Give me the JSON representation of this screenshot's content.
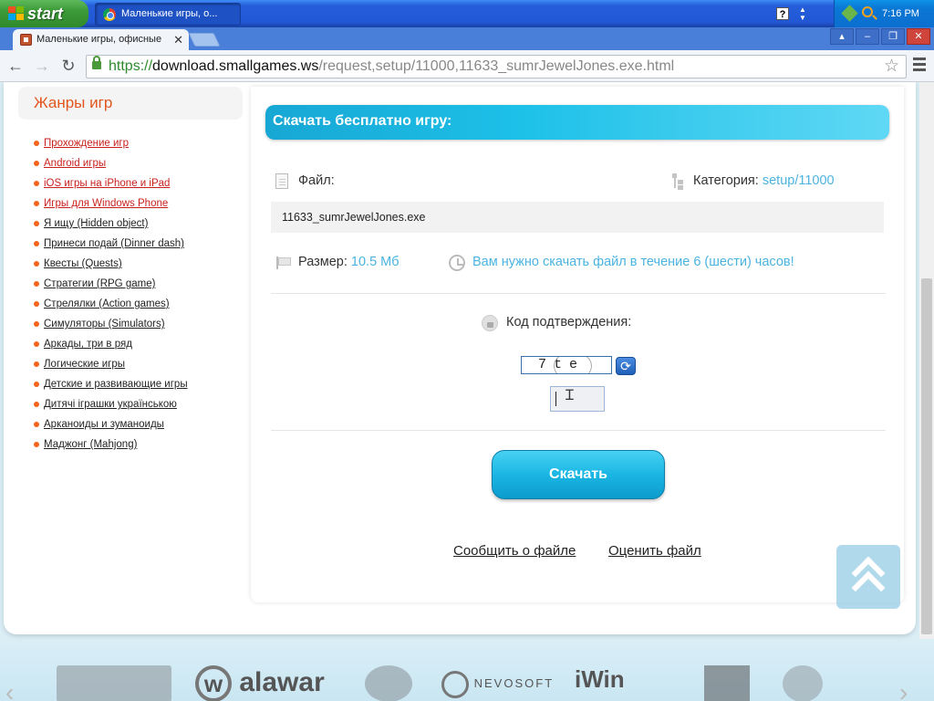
{
  "taskbar": {
    "start_label": "start",
    "task_label": "Маленькие игры, о...",
    "help_glyph": "?",
    "clock": "7:16 PM"
  },
  "browser": {
    "tab_title": "Маленькие игры, офисные",
    "tab_close": "✕",
    "url_scheme": "https://",
    "url_host": "download.smallgames.ws",
    "url_path": "/request,setup/11000,11633_sumrJewelJones.exe.html",
    "window_buttons": [
      "▴",
      "‒",
      "❐",
      "✕"
    ]
  },
  "sidebar": {
    "title": "Жанры игр",
    "genres": [
      {
        "label": "Прохождение игр",
        "red": true
      },
      {
        "label": "Android игры",
        "red": true
      },
      {
        "label": "iOS игры на iPhone и iPad",
        "red": true
      },
      {
        "label": "Игры для Windows Phone",
        "red": true
      },
      {
        "label": "Я ищу (Hidden object)",
        "red": false
      },
      {
        "label": "Принеси подай (Dinner dash)",
        "red": false
      },
      {
        "label": "Квесты (Quests)",
        "red": false
      },
      {
        "label": "Стратегии (RPG game)",
        "red": false
      },
      {
        "label": "Стрелялки (Action games)",
        "red": false
      },
      {
        "label": "Симуляторы (Simulators)",
        "red": false
      },
      {
        "label": "Аркады, три в ряд",
        "red": false
      },
      {
        "label": "Логические игры",
        "red": false
      },
      {
        "label": "Детские и развивающие игры",
        "red": false
      },
      {
        "label": "Дитячі іграшки українською",
        "red": false
      },
      {
        "label": "Арканоиды и зуманоиды",
        "red": false
      },
      {
        "label": "Маджонг (Mahjong)",
        "red": false
      }
    ]
  },
  "download": {
    "header": "Скачать бесплатно игру:",
    "file_label": "Файл:",
    "category_label": "Категория:",
    "category_value": "setup/11000",
    "file_name": "11633_sumrJewelJones.exe",
    "size_label": "Размер:",
    "size_value": "10.5 Мб",
    "time_notice": "Вам нужно скачать файл в течение 6 (шести) часов!",
    "code_label": "Код подтверждения:",
    "captcha_text": "7te",
    "code_value": "",
    "download_button": "Скачать",
    "report_link": "Сообщить о файле",
    "rate_link": "Оценить файл"
  },
  "partners": {
    "logos": [
      "alawar",
      "NEVOSOFT",
      "iWin"
    ]
  }
}
